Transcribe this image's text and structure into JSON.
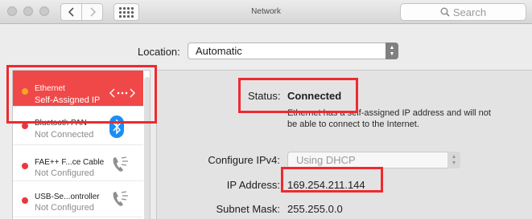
{
  "window": {
    "title": "Network"
  },
  "search": {
    "placeholder": "Search"
  },
  "location": {
    "label": "Location:",
    "value": "Automatic"
  },
  "services": [
    {
      "name": "Ethernet",
      "status": "Self-Assigned IP",
      "dot_color": "#f5a623",
      "icon": "ethernet-arrows-icon",
      "selected": true
    },
    {
      "name": "Bluetooth PAN",
      "status": "Not Connected",
      "dot_color": "#e6393f",
      "icon": "bluetooth-icon",
      "selected": false
    },
    {
      "name": "FAE++ F...ce Cable",
      "status": "Not Configured",
      "dot_color": "#e6393f",
      "icon": "phone-icon",
      "selected": false
    },
    {
      "name": "USB-Se...ontroller",
      "status": "Not Configured",
      "dot_color": "#e6393f",
      "icon": "phone-icon",
      "selected": false
    }
  ],
  "detail": {
    "status_label": "Status:",
    "status_value": "Connected",
    "status_description": "Ethernet has a self-assigned IP address and will not be able to connect to the Internet.",
    "configure_label": "Configure IPv4:",
    "configure_value": "Using DHCP",
    "ip_label": "IP Address:",
    "ip_value": "169.254.211.144",
    "subnet_label": "Subnet Mask:",
    "subnet_value": "255.255.0.0"
  },
  "colors": {
    "selection": "#f04848",
    "highlight": "#ee2a2f",
    "bluetooth": "#1a8ef5"
  }
}
